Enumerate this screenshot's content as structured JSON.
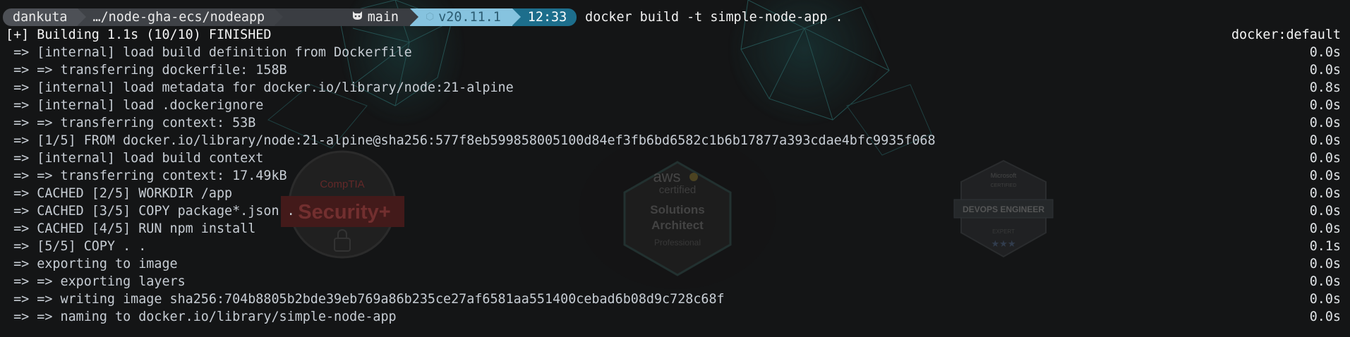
{
  "prompt": {
    "user": "dankuta",
    "path": "…/node-gha-ecs/nodeapp",
    "git_icon": "octocat-icon",
    "branch": "main",
    "node_icon": "node-hexagon-icon",
    "node_version": "v20.11.1",
    "time": "12:33",
    "command": "docker build -t simple-node-app ."
  },
  "build": {
    "header": "[+] Building 1.1s (10/10) FINISHED",
    "context": "docker:default",
    "steps": [
      {
        "text": " => [internal] load build definition from Dockerfile",
        "time": "0.0s"
      },
      {
        "text": " => => transferring dockerfile: 158B",
        "time": "0.0s"
      },
      {
        "text": " => [internal] load metadata for docker.io/library/node:21-alpine",
        "time": "0.8s"
      },
      {
        "text": " => [internal] load .dockerignore",
        "time": "0.0s"
      },
      {
        "text": " => => transferring context: 53B",
        "time": "0.0s"
      },
      {
        "text": " => [1/5] FROM docker.io/library/node:21-alpine@sha256:577f8eb599858005100d84ef3fb6bd6582c1b6b17877a393cdae4bfc9935f068",
        "time": "0.0s"
      },
      {
        "text": " => [internal] load build context",
        "time": "0.0s"
      },
      {
        "text": " => => transferring context: 17.49kB",
        "time": "0.0s"
      },
      {
        "text": " => CACHED [2/5] WORKDIR /app",
        "time": "0.0s"
      },
      {
        "text": " => CACHED [3/5] COPY package*.json .",
        "time": "0.0s"
      },
      {
        "text": " => CACHED [4/5] RUN npm install",
        "time": "0.0s"
      },
      {
        "text": " => [5/5] COPY . .",
        "time": "0.1s"
      },
      {
        "text": " => exporting to image",
        "time": "0.0s"
      },
      {
        "text": " => => exporting layers",
        "time": "0.0s"
      },
      {
        "text": " => => writing image sha256:704b8805b2bde39eb769a86b235ce27af6581aa551400cebad6b08d9c728c68f",
        "time": "0.0s"
      },
      {
        "text": " => => naming to docker.io/library/simple-node-app",
        "time": "0.0s"
      }
    ]
  },
  "wallpaper": {
    "comptia_brand": "CompTIA",
    "comptia_cert": "Security+",
    "aws_brand": "aws",
    "aws_certified": "certified",
    "aws_line1": "Solutions",
    "aws_line2": "Architect",
    "aws_level": "Professional",
    "ms_brand": "Microsoft",
    "ms_certified": "CERTIFIED",
    "ms_role": "DEVOPS ENGINEER",
    "ms_level": "EXPERT"
  },
  "colors": {
    "background": "#141516",
    "text": "#dcdcdc",
    "segment_user": "#4d5056",
    "segment_node": "#86c3df",
    "segment_time": "#1d6e8c",
    "wallpaper_teal": "#1b4a4c"
  }
}
